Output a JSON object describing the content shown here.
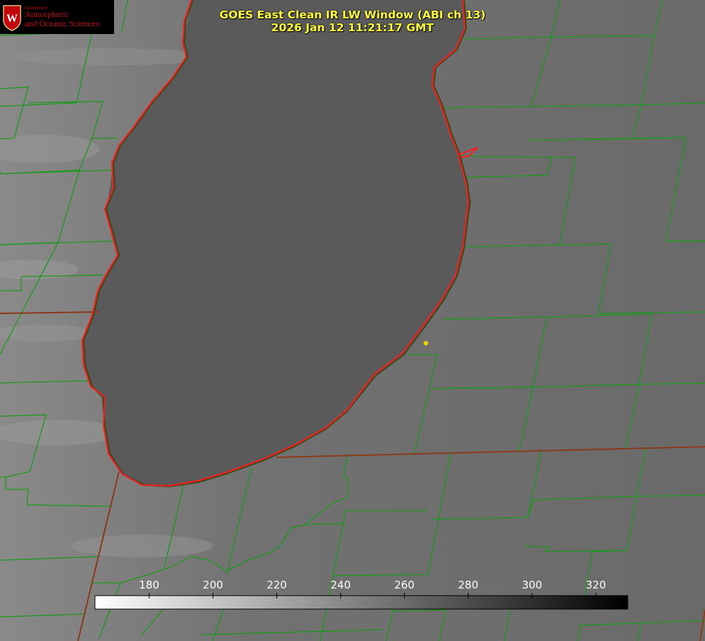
{
  "logo": {
    "department": "Department of",
    "line1": "Atmospheric",
    "line2": "and Oceanic Sciences",
    "seal_letter": "W",
    "color": "#c5050c",
    "icon": "uw-crest-icon"
  },
  "title": {
    "line1": "GOES East Clean IR LW Window (ABI ch 13)",
    "line2": "2026 Jan 12 11:21:17 GMT",
    "color": "#ffff33"
  },
  "colorbar": {
    "ticks": [
      {
        "label": "180",
        "value": 180
      },
      {
        "label": "200",
        "value": 200
      },
      {
        "label": "220",
        "value": 220
      },
      {
        "label": "240",
        "value": 240
      },
      {
        "label": "260",
        "value": 260
      },
      {
        "label": "280",
        "value": 280
      },
      {
        "label": "300",
        "value": 300
      },
      {
        "label": "320",
        "value": 320
      }
    ],
    "range": [
      163,
      330
    ],
    "gradient": [
      "#ffffff",
      "#000000"
    ]
  },
  "map_colors": {
    "county_lines": "#1a9a1a",
    "state_lines": "#8b3a1a",
    "lake_outline": "#ff1a1a",
    "marker": "#e8d800",
    "lake_fill": "#5a5a5a",
    "land_fill": "#6e6e6e"
  }
}
